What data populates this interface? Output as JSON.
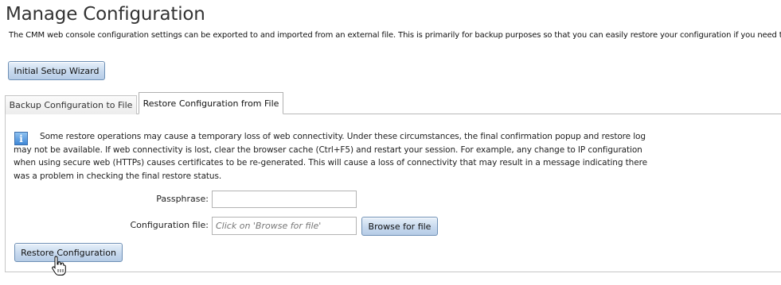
{
  "header": {
    "title": "Manage Configuration",
    "description": "The CMM web console configuration settings can be exported to and imported from an external file. This is primarily for backup purposes so that you can easily restore your configuration if you need to."
  },
  "wizard_button": {
    "label": "Initial Setup Wizard"
  },
  "tabs": [
    {
      "label": "Backup Configuration to File",
      "selected": false
    },
    {
      "label": "Restore Configuration from File",
      "selected": true
    }
  ],
  "restore_panel": {
    "info_icon": "info-icon",
    "info_text": "Some restore operations may cause a temporary loss of web connectivity. Under these circumstances, the final confirmation popup and restore log may not be available. If web connectivity is lost, clear the browser cache (Ctrl+F5) and restart your session. For example, any change to IP configuration when using secure web (HTTPs) causes certificates to be re-generated. This will cause a loss of connectivity that may result in a message indicating there was a problem in checking the final restore status.",
    "passphrase": {
      "label": "Passphrase:",
      "value": ""
    },
    "config_file": {
      "label": "Configuration file:",
      "value": "",
      "placeholder": "Click on 'Browse for file'"
    },
    "browse_button": {
      "label": "Browse for file"
    },
    "restore_button": {
      "label": "Restore Configuration"
    }
  },
  "colors": {
    "button_border": "#6d8fb5",
    "button_fill": "#c7d9ee",
    "info_icon": "#3f87d6"
  }
}
